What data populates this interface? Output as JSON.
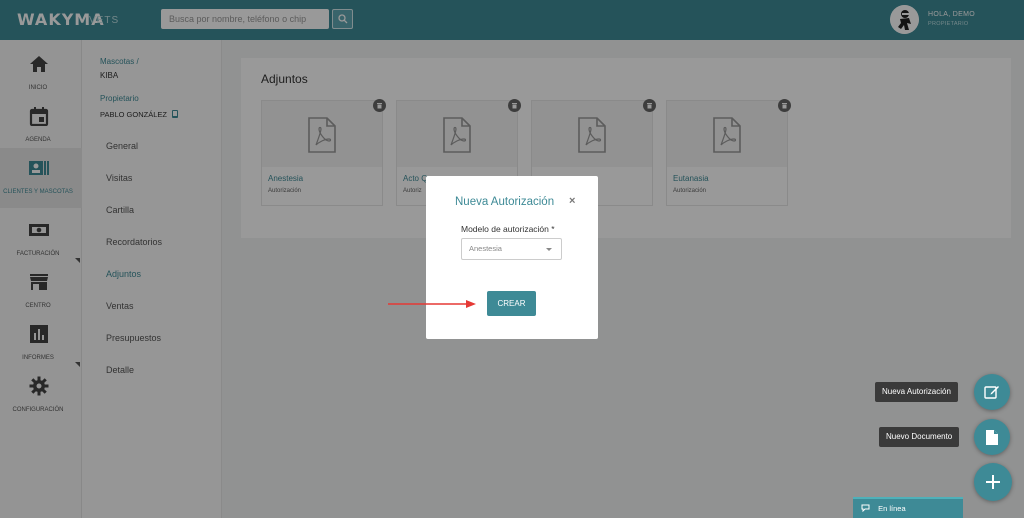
{
  "app": {
    "logo": "WAKYMA",
    "logo_sub": "VETS"
  },
  "search": {
    "placeholder": "Busca por nombre, teléfono o chip"
  },
  "user": {
    "greeting": "HOLA, DEMO",
    "role": "PROPIETARIO"
  },
  "sidebar": {
    "items": [
      {
        "label": "INICIO",
        "icon": "home-icon"
      },
      {
        "label": "AGENDA",
        "icon": "calendar-icon"
      },
      {
        "label": "CLIENTES Y MASCOTAS",
        "icon": "contacts-icon"
      },
      {
        "label": "FACTURACIÓN",
        "icon": "money-icon"
      },
      {
        "label": "CENTRO",
        "icon": "store-icon"
      },
      {
        "label": "INFORMES",
        "icon": "chart-icon"
      },
      {
        "label": "CONFIGURACIÓN",
        "icon": "gear-icon"
      }
    ]
  },
  "subnav": {
    "breadcrumb": "Mascotas /",
    "pet_name": "KIBA",
    "owner_label": "Propietario",
    "owner_name": "PABLO GONZÁLEZ",
    "items": [
      "General",
      "Visitas",
      "Cartilla",
      "Recordatorios",
      "Adjuntos",
      "Ventas",
      "Presupuestos",
      "Detalle"
    ],
    "active": "Adjuntos"
  },
  "main": {
    "title": "Adjuntos",
    "cards": [
      {
        "title": "Anestesia",
        "sub": "Autorización"
      },
      {
        "title": "Acto Q",
        "sub": "Autoriz"
      },
      {
        "title": "",
        "sub": ""
      },
      {
        "title": "Eutanasia",
        "sub": "Autorización"
      }
    ]
  },
  "modal": {
    "title": "Nueva Autorización",
    "close": "×",
    "field_label": "Modelo de autorización *",
    "selected": "Anestesia",
    "submit": "CREAR"
  },
  "fabs": {
    "new_authorization": "Nueva Autorización",
    "new_document": "Nuevo Documento"
  },
  "chat": {
    "status": "En línea"
  },
  "colors": {
    "accent": "#3e8a96",
    "annotation_arrow": "#e53935"
  }
}
